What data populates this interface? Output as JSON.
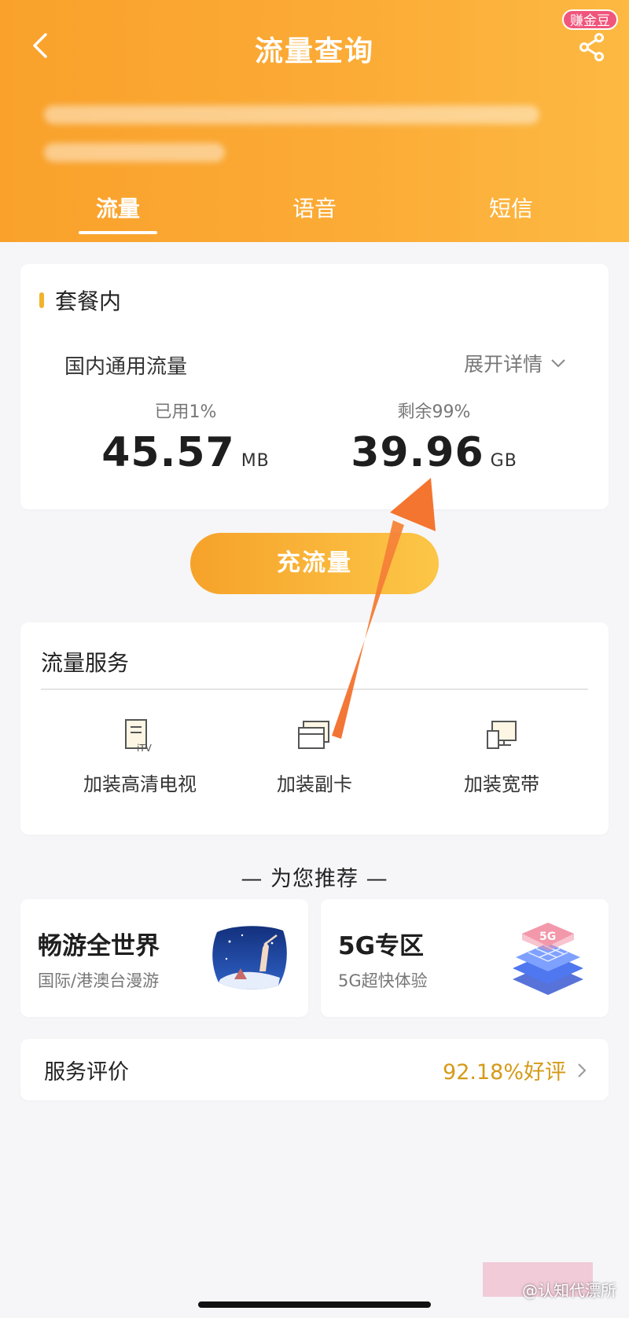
{
  "header": {
    "title": "流量查询",
    "badge": "赚金豆",
    "tabs": [
      {
        "label": "流量",
        "active": true
      },
      {
        "label": "语音",
        "active": false
      },
      {
        "label": "短信",
        "active": false
      }
    ]
  },
  "colors": {
    "header_gradient": [
      "#f9a12b",
      "#fdb942"
    ],
    "accent": "#f0b32a",
    "rating": "#d59a18",
    "arrow": "#f37a2a"
  },
  "package": {
    "section_title": "套餐内",
    "label": "国内通用流量",
    "expand": "展开详情",
    "used": {
      "caption": "已用1%",
      "value": "45.57",
      "unit": "MB"
    },
    "remaining": {
      "caption": "剩余99%",
      "value": "39.96",
      "unit": "GB"
    }
  },
  "recharge_button": "充流量",
  "services": {
    "title": "流量服务",
    "items": [
      {
        "label": "加装高清电视",
        "icon": "itv-icon"
      },
      {
        "label": "加装副卡",
        "icon": "sim-card-icon"
      },
      {
        "label": "加装宽带",
        "icon": "broadband-icon"
      }
    ]
  },
  "recommend": {
    "heading": "— 为您推荐 —",
    "cards": [
      {
        "title": "畅游全世界",
        "subtitle": "国际/港澳台漫游",
        "icon": "travel-illustration"
      },
      {
        "title": "5G专区",
        "subtitle": "5G超快体验",
        "icon": "5g-chip-illustration"
      }
    ]
  },
  "rating": {
    "label": "服务评价",
    "value": "92.18%好评"
  },
  "watermark": "@认知代漂所"
}
